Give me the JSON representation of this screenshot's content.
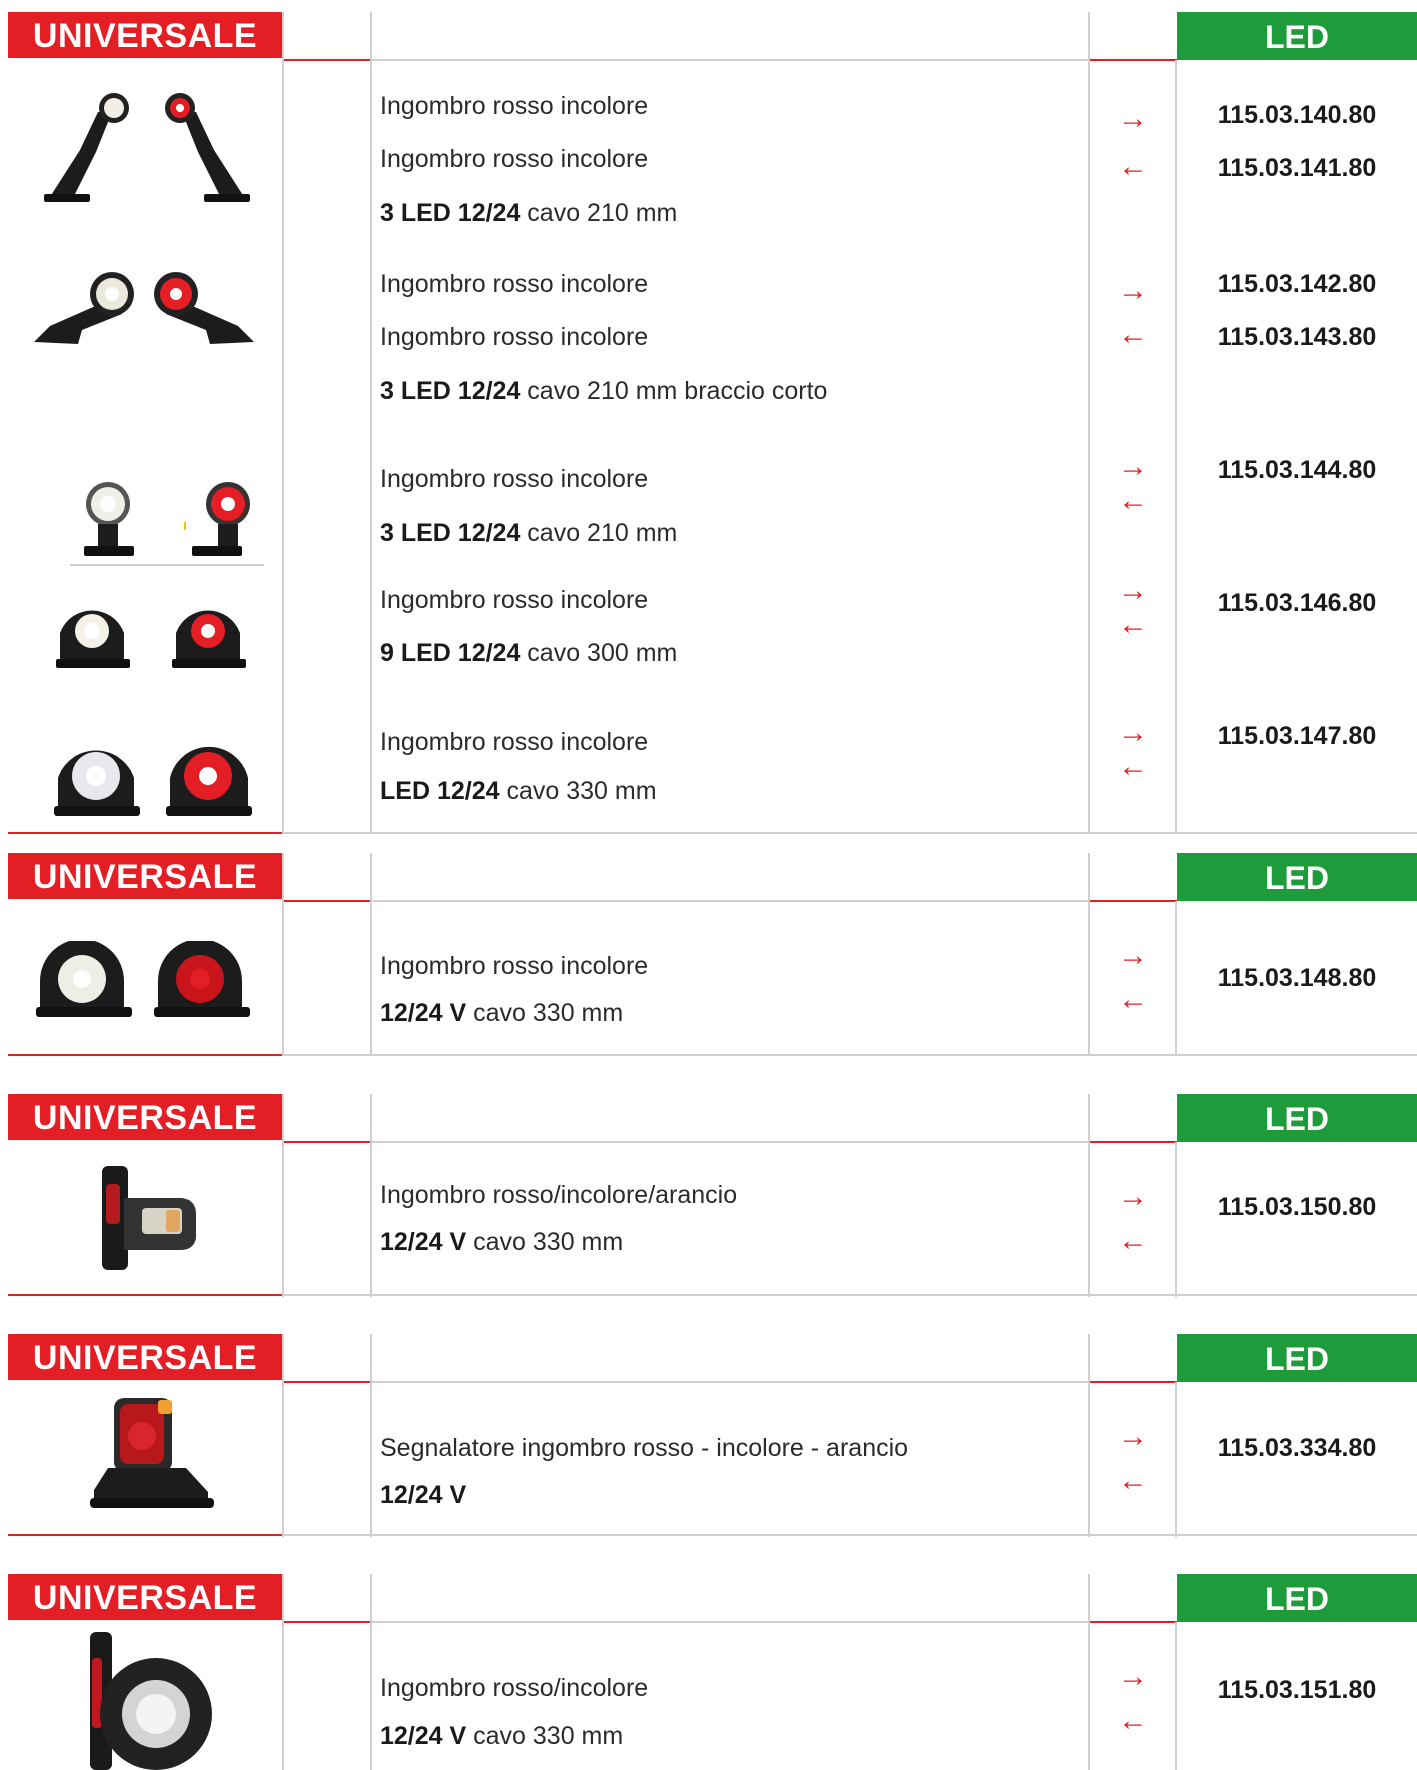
{
  "sections": [
    {
      "header": "UNIVERSALE",
      "badge": "LED",
      "rows": [
        {
          "desc": "Ingombro rosso incolore",
          "code": "115.03.140.80"
        },
        {
          "desc": "Ingombro rosso incolore",
          "code": "115.03.141.80"
        },
        {
          "bold": "3 LED 12/24",
          "rest": " cavo 210 mm"
        },
        {
          "desc": "Ingombro rosso incolore",
          "code": "115.03.142.80"
        },
        {
          "desc": "Ingombro rosso incolore",
          "code": "115.03.143.80"
        },
        {
          "bold": "3 LED 12/24",
          "rest": " cavo 210 mm braccio corto"
        },
        {
          "desc": "Ingombro rosso incolore",
          "code": "115.03.144.80"
        },
        {
          "bold": "3 LED 12/24",
          "rest": " cavo 210 mm"
        },
        {
          "desc": "Ingombro rosso incolore",
          "code": "115.03.146.80"
        },
        {
          "bold": "9 LED 12/24",
          "rest": " cavo 300 mm"
        },
        {
          "desc": "Ingombro rosso incolore",
          "code": "115.03.147.80"
        },
        {
          "bold": "LED 12/24",
          "rest": " cavo 330 mm"
        }
      ]
    },
    {
      "header": "UNIVERSALE",
      "badge": "LED",
      "desc": "Ingombro rosso incolore",
      "bold": "12/24 V",
      "rest": " cavo 330 mm",
      "code": "115.03.148.80"
    },
    {
      "header": "UNIVERSALE",
      "badge": "LED",
      "desc": "Ingombro rosso/incolore/arancio",
      "bold": "12/24 V",
      "rest": "  cavo 330 mm",
      "code": "115.03.150.80"
    },
    {
      "header": "UNIVERSALE",
      "badge": "LED",
      "desc": "Segnalatore ingombro rosso - incolore - arancio",
      "bold": "12/24 V",
      "rest": "",
      "code": "115.03.334.80"
    },
    {
      "header": "UNIVERSALE",
      "badge": "LED",
      "desc": "Ingombro rosso/incolore",
      "bold": "12/24 V",
      "rest": "  cavo 330 mm",
      "code": "115.03.151.80"
    }
  ],
  "arrows": {
    "right": "→",
    "left": "←"
  },
  "colors": {
    "accent_red": "#e31e24",
    "led_green": "#1e9b3a"
  }
}
